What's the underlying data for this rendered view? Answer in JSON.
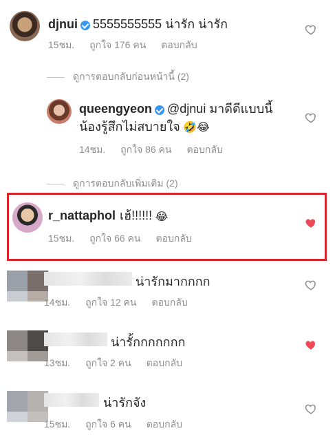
{
  "comments": [
    {
      "username": "djnui",
      "text": "5555555555  น่ารัก น่ารัก",
      "time": "15ชม.",
      "likes": "ถูกใจ 176 คน",
      "reply": "ตอบกลับ",
      "liked": false
    },
    {
      "username": "queengyeon",
      "text_line1": "@djnui มาดีดีแบบนี้",
      "text_line2": "น้องรู้สึกไม่สบายใจ",
      "time": "14ชม.",
      "likes": "ถูกใจ 86 คน",
      "reply": "ตอบกลับ",
      "liked": false
    },
    {
      "username": "r_nattaphol",
      "text": "เฮ้!!!!!!",
      "time": "15ชม.",
      "likes": "ถูกใจ 66 คน",
      "reply": "ตอบกลับ",
      "liked": true
    },
    {
      "text": "น่ารักมากกกก",
      "time": "14ชม.",
      "likes": "ถูกใจ 12 คน",
      "reply": "ตอบกลับ",
      "liked": false
    },
    {
      "text": "น่ารั้กกกกกกก",
      "time": "13ชม.",
      "likes": "ถูกใจ 2 คน",
      "reply": "ตอบกลับ",
      "liked": true
    },
    {
      "text": "น่ารักจัง",
      "time": "15ชม.",
      "likes": "ถูกใจ 6 คน",
      "reply": "ตอบกลับ",
      "liked": false
    }
  ],
  "view_previous_replies": "ดูการตอบกลับก่อนหน้านี้ (2)",
  "view_more_replies": "ดูการตอบกลับเพิ่มเติม (2)",
  "emojis": {
    "rofl": "🤣",
    "joy": "😂"
  },
  "colors": {
    "highlight_border": "#d9262c",
    "heart_liked": "#ed4956",
    "heart_outline": "#8e8e8e",
    "verified": "#3897f0",
    "meta_text": "#8e8e8e"
  }
}
